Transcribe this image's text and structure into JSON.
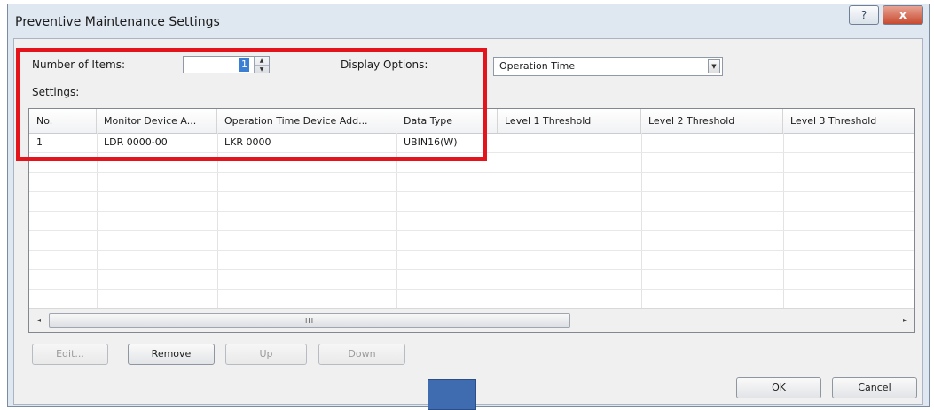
{
  "window": {
    "title": "Preventive Maintenance Settings",
    "help_icon": "?",
    "close_icon": "x"
  },
  "form": {
    "number_of_items_label": "Number of Items:",
    "number_of_items_value": "1",
    "display_options_label": "Display Options:",
    "display_options_value": "Operation Time",
    "settings_label": "Settings:"
  },
  "table": {
    "columns": [
      "No.",
      "Monitor Device A...",
      "Operation Time Device Add...",
      "Data Type",
      "Level 1 Threshold",
      "Level 2 Threshold",
      "Level 3 Threshold"
    ],
    "rows": [
      [
        "1",
        "LDR 0000-00",
        "LKR 0000",
        "UBIN16(W)",
        "",
        "",
        ""
      ]
    ]
  },
  "scrollbar": {
    "left_arrow": "◂",
    "right_arrow": "▸",
    "grip": "III"
  },
  "buttons": {
    "edit": "Edit...",
    "remove": "Remove",
    "up": "Up",
    "down": "Down",
    "ok": "OK",
    "cancel": "Cancel"
  },
  "colors": {
    "highlight": "#e3141c",
    "selection": "#3b7fd4",
    "overlay_box": "#3f6bb0"
  }
}
